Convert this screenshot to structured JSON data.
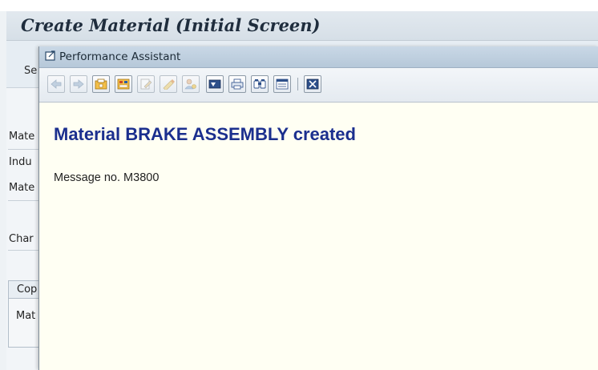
{
  "background": {
    "title": "Create Material (Initial Screen)",
    "toolbar_button": "Se",
    "fields": [
      "Mate",
      "Indu",
      "Mate",
      "Char"
    ],
    "tab_label": "Cop",
    "group_label": "Mat"
  },
  "popup": {
    "title": "Performance Assistant",
    "toolbar": [
      {
        "icon": "back-arrow-icon",
        "enabled": false
      },
      {
        "icon": "forward-arrow-icon",
        "enabled": false
      },
      {
        "icon": "technical-info-icon",
        "enabled": true
      },
      {
        "icon": "application-help-icon",
        "enabled": true
      },
      {
        "icon": "edit-document-icon",
        "enabled": false
      },
      {
        "icon": "highlight-pen-icon",
        "enabled": false
      },
      {
        "icon": "user-settings-icon",
        "enabled": false
      },
      {
        "icon": "display-icon",
        "enabled": true
      },
      {
        "icon": "print-icon",
        "enabled": true
      },
      {
        "icon": "find-icon",
        "enabled": true
      },
      {
        "icon": "settings-icon",
        "enabled": true
      },
      {
        "icon": "close-icon",
        "enabled": true
      }
    ],
    "message": {
      "headline": "Material BRAKE ASSEMBLY created",
      "number": "Message no. M3800"
    }
  },
  "colors": {
    "headline": "#1b2f8e",
    "popup_background": "#fffff3",
    "titlebar": "#b6c8d9"
  }
}
